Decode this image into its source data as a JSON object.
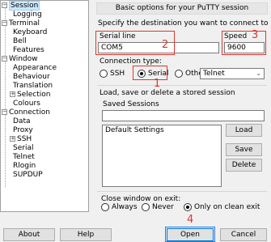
{
  "tree": {
    "items": [
      {
        "label": "Session",
        "level": 0,
        "expander": "-",
        "selected": true
      },
      {
        "label": "Logging",
        "level": 1
      },
      {
        "label": "Terminal",
        "level": 0,
        "expander": "-"
      },
      {
        "label": "Keyboard",
        "level": 1
      },
      {
        "label": "Bell",
        "level": 1
      },
      {
        "label": "Features",
        "level": 1
      },
      {
        "label": "Window",
        "level": 0,
        "expander": "-"
      },
      {
        "label": "Appearance",
        "level": 1
      },
      {
        "label": "Behaviour",
        "level": 1
      },
      {
        "label": "Translation",
        "level": 1
      },
      {
        "label": "Selection",
        "level": 1,
        "expander": "+"
      },
      {
        "label": "Colours",
        "level": 1
      },
      {
        "label": "Connection",
        "level": 0,
        "expander": "-"
      },
      {
        "label": "Data",
        "level": 1
      },
      {
        "label": "Proxy",
        "level": 1
      },
      {
        "label": "SSH",
        "level": 1,
        "expander": "+"
      },
      {
        "label": "Serial",
        "level": 1
      },
      {
        "label": "Telnet",
        "level": 1
      },
      {
        "label": "Rlogin",
        "level": 1
      },
      {
        "label": "SUPDUP",
        "level": 1
      }
    ]
  },
  "session": {
    "banner": "Basic options for your PuTTY session",
    "destination_label": "Specify the destination you want to connect to",
    "serial_line_label": "Serial line",
    "serial_line_value": "COM5",
    "speed_label": "Speed",
    "speed_value": "9600",
    "connection_type_label": "Connection type:",
    "conn_ssh": "SSH",
    "conn_serial": "Serial",
    "conn_other": "Other:",
    "conn_other_value": "Telnet",
    "load_save_label": "Load, save or delete a stored session",
    "saved_sessions_label": "Saved Sessions",
    "saved_sessions_value": "",
    "sessions_list": [
      "Default Settings"
    ],
    "load_btn": "Load",
    "save_btn": "Save",
    "delete_btn": "Delete",
    "close_label": "Close window on exit:",
    "close_always": "Always",
    "close_never": "Never",
    "close_clean": "Only on clean exit"
  },
  "footer": {
    "about": "About",
    "help": "Help",
    "open": "Open",
    "cancel": "Cancel"
  },
  "annotations": [
    "1",
    "2",
    "3",
    "4"
  ],
  "colors": {
    "annotation": "#e0362c",
    "focus": "#2a7ae2"
  }
}
